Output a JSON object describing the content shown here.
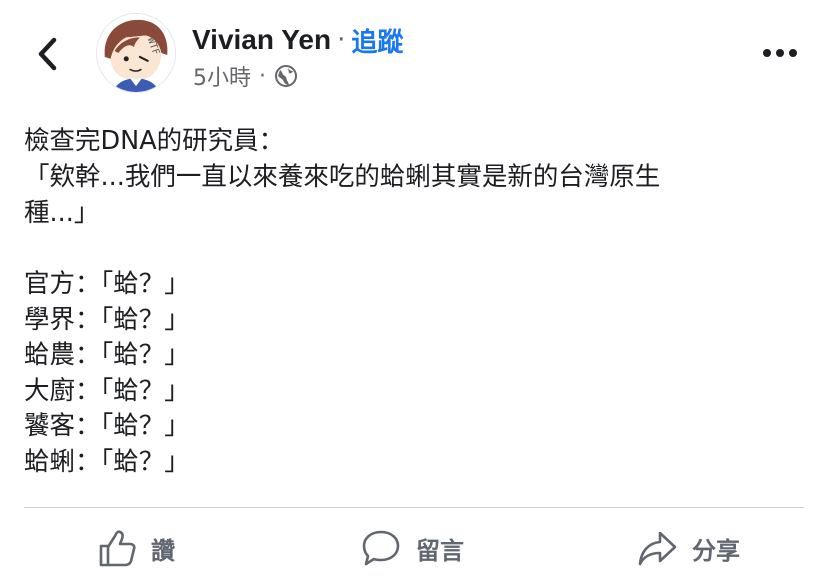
{
  "header": {
    "back_icon": "chevron-left-icon",
    "avatar_icon": "cartoon-avatar-icon",
    "avatar_scribble": "WTF",
    "author_name": "Vivian Yen",
    "separator": "·",
    "follow_label": "追蹤",
    "timestamp": "5小時",
    "meta_separator": "·",
    "privacy_icon": "globe-icon",
    "more_icon": "more-dots-icon"
  },
  "post": {
    "lines": [
      "檢查完DNA的研究員：",
      "「欸幹...我們一直以來養來吃的蛤蜊其實是新的台灣原生",
      "種...」"
    ],
    "replies": [
      "官方：「蛤？」",
      "學界：「蛤？」",
      "蛤農：「蛤？」",
      "大廚：「蛤？」",
      "饕客：「蛤？」",
      "蛤蜊：「蛤？」"
    ]
  },
  "actions": {
    "like_label": "讚",
    "comment_label": "留言",
    "share_label": "分享",
    "like_icon": "thumbs-up-icon",
    "comment_icon": "speech-bubble-icon",
    "share_icon": "share-arrow-icon"
  },
  "colors": {
    "follow": "#1877f2",
    "meta_text": "#65676b",
    "action_text": "#606770",
    "divider": "#ced0d4"
  }
}
